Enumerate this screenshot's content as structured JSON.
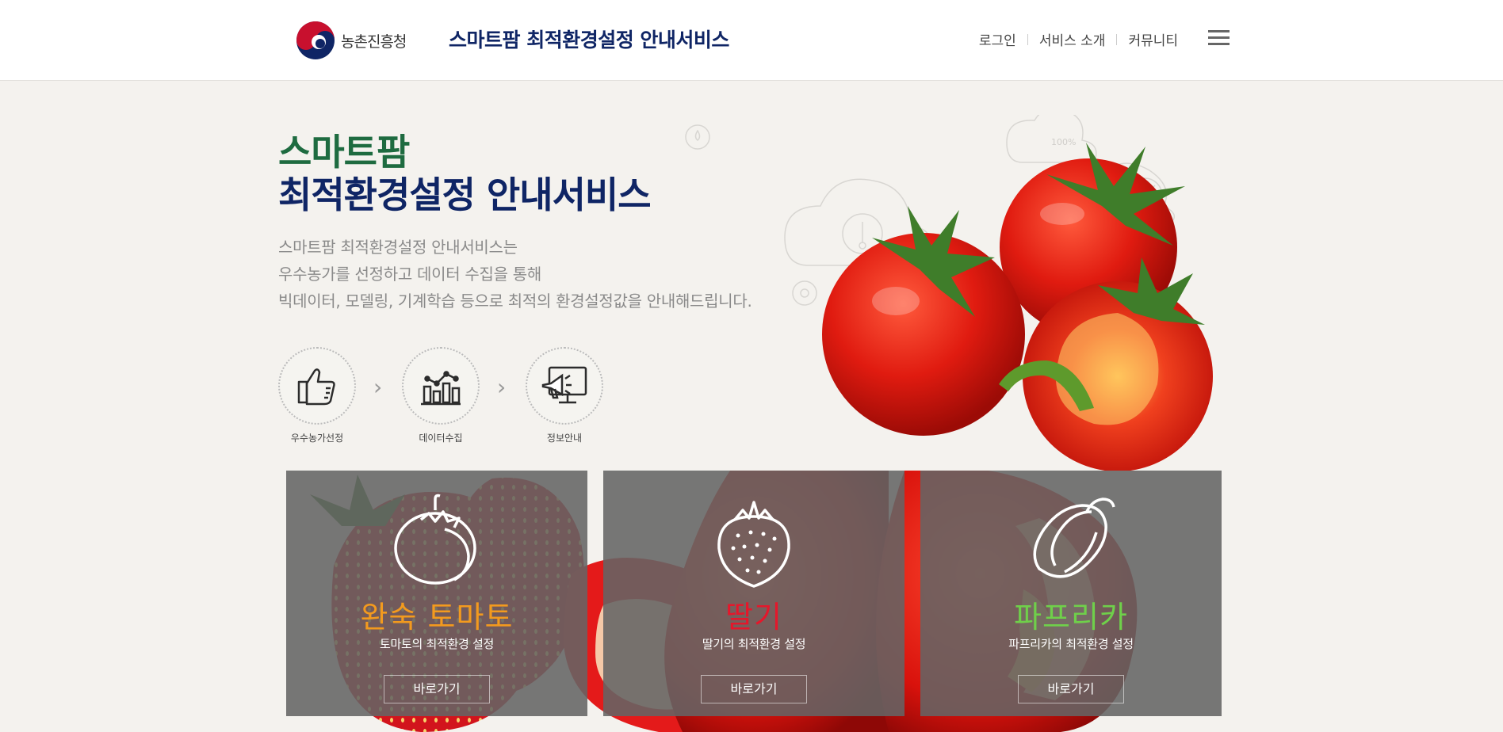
{
  "header": {
    "logo_text": "농촌진흥청",
    "site_title": "스마트팜 최적환경설정 안내서비스",
    "nav": [
      "로그인",
      "서비스 소개",
      "커뮤니티"
    ]
  },
  "hero": {
    "title_line1": "스마트팜",
    "title_line2": "최적환경설정 안내서비스",
    "desc_lines": [
      "스마트팜 최적환경설정 안내서비스는",
      "우수농가를 선정하고 데이터 수집을 통해",
      "빅데이터, 모델링, 기계학습 등으로 최적의 환경설정값을 안내해드립니다."
    ],
    "steps": [
      {
        "label": "우수농가선정",
        "icon": "thumbs-up-icon"
      },
      {
        "label": "데이터수집",
        "icon": "bar-chart-icon"
      },
      {
        "label": "정보안내",
        "icon": "monitor-megaphone-icon"
      }
    ],
    "humidity_label": "100%"
  },
  "cards": [
    {
      "title": "완숙 토마토",
      "sub": "토마토의 최적환경 설정",
      "button": "바로가기",
      "color": "#f39a1e",
      "icon": "tomato-icon"
    },
    {
      "title": "딸기",
      "sub": "딸기의 최적환경 설정",
      "button": "바로가기",
      "color": "#e5172b",
      "icon": "strawberry-icon"
    },
    {
      "title": "파프리카",
      "sub": "파프리카의 최적환경 설정",
      "button": "바로가기",
      "color": "#6fd04a",
      "icon": "paprika-icon"
    }
  ],
  "colors": {
    "navy": "#0f2565",
    "green": "#1e6b40",
    "background": "#f4f2ee"
  }
}
